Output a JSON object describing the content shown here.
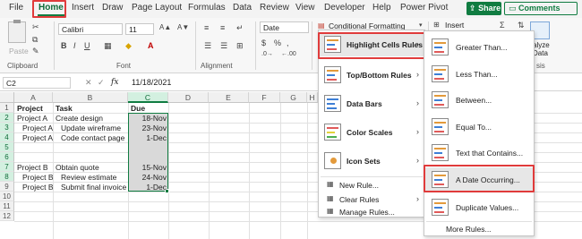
{
  "tabs": [
    "File",
    "Home",
    "Insert",
    "Draw",
    "Page Layout",
    "Formulas",
    "Data",
    "Review",
    "View",
    "Developer",
    "Help",
    "Power Pivot"
  ],
  "share_label": "Share",
  "comments_label": "Comments",
  "ribbon": {
    "paste_label": "Paste",
    "clipboard_label": "Clipboard",
    "font_name": "Calibri",
    "font_size": "11",
    "font_label": "Font",
    "alignment_label": "Alignment",
    "number_format": "Date",
    "cf_label": "Conditional Formatting",
    "insert_label": "Insert",
    "analyze_label": "alyze\nData",
    "sis_label": "sis"
  },
  "formula_bar": {
    "name_box": "C2",
    "fx": "fx",
    "value": "11/18/2021"
  },
  "columns": [
    "A",
    "B",
    "C",
    "D",
    "E",
    "F",
    "G",
    "H"
  ],
  "rows": [
    "1",
    "2",
    "3",
    "4",
    "5",
    "6",
    "7",
    "8",
    "9",
    "10",
    "11",
    "12"
  ],
  "cells": {
    "headers": [
      "Project",
      "Task",
      "Due"
    ],
    "rows": [
      {
        "a": "Project A",
        "b": "Create design",
        "c": "18-Nov"
      },
      {
        "a": "Project A",
        "b": "Update wireframe",
        "c": "23-Nov"
      },
      {
        "a": "Project A",
        "b": "Code contact page",
        "c": "1-Dec"
      },
      {
        "a": "",
        "b": "",
        "c": ""
      },
      {
        "a": "Project B",
        "b": "Obtain quote",
        "c": "15-Nov"
      },
      {
        "a": "Project B",
        "b": "Review estimate",
        "c": "24-Nov"
      },
      {
        "a": "Project B",
        "b": "Submit final invoice",
        "c": "1-Dec"
      }
    ]
  },
  "cf_menu": {
    "items": [
      "Highlight Cells Rules",
      "Top/Bottom Rules",
      "Data Bars",
      "Color Scales",
      "Icon Sets"
    ],
    "small_items": [
      "New Rule...",
      "Clear Rules",
      "Manage Rules..."
    ]
  },
  "hcr_menu": {
    "items": [
      "Greater Than...",
      "Less Than...",
      "Between...",
      "Equal To...",
      "Text that Contains...",
      "A Date Occurring...",
      "Duplicate Values..."
    ],
    "more": "More Rules..."
  },
  "accent": "#107c41",
  "highlight": "#e03b3b"
}
